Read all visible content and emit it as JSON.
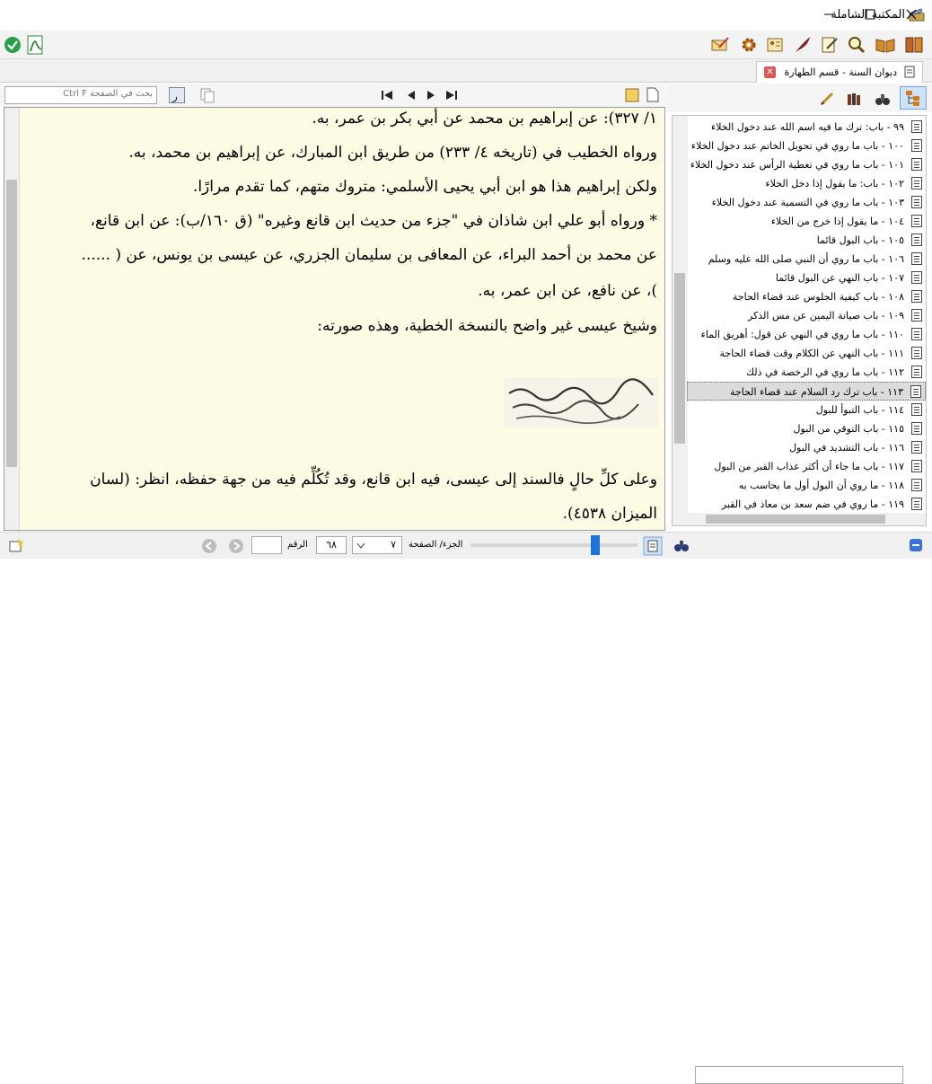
{
  "window": {
    "title": "المكتبة الشاملة"
  },
  "tab": {
    "label": "ديوان السنة - قسم الطهارة"
  },
  "reader": {
    "search_placeholder": "بحث في الصفحة  Ctrl  F",
    "lines": [
      "١/ ٣٢٧): عن إبراهيم بن محمد عن أبي بكر بن عمر، به.",
      "ورواه الخطيب في (تاريخه ٤/ ٢٣٣) من طريق ابن المبارك، عن إبراهيم بن محمد، به.",
      "ولكن إبراهيم هذا هو ابن أبي يحيى الأسلمي: متروك متهم، كما تقدم مرارًا.",
      "* ورواه أبو علي ابن شاذان في \"جزء من حديث ابن قانع وغيره\" (ق ١٦٠/ب): عن ابن قانع،",
      "عن محمد بن أحمد البراء، عن المعافى بن سليمان الجزري، عن عيسى بن يونس، عن ( ......",
      ")، عن نافع، عن ابن عمر، به.",
      "وشيخ عيسى غير واضح بالنسخة الخطية، وهذه صورته:",
      "وعلى كلِّ حالٍ فالسند إلى عيسى، فيه ابن قانع، وقد تُكُلِّم فيه من جهة حفظه، انظر: (لسان",
      "الميزان ٤٥٣٨)."
    ]
  },
  "statusbar": {
    "part_label": "الجزء/ الصفحة",
    "part_value": "٧",
    "page_value": "٦٨",
    "number_label": "الرقم",
    "number_value": ""
  },
  "tree": {
    "items": [
      {
        "label": "٩٩ - باب: ترك ما فيه اسم الله عند دخول الخلاء"
      },
      {
        "label": "١٠٠ - باب ما روي في تحويل الخاتم عند دخول الخلاء"
      },
      {
        "label": "١٠١ - باب ما روي في تغطية الرأس عند دخول الخلاء"
      },
      {
        "label": "١٠٢ - باب: ما يقول إذا دخل الخلاء"
      },
      {
        "label": "١٠٣ - باب ما روي في التسمية عند دخول الخلاء"
      },
      {
        "label": "١٠٤ - ما يقول إذا خرج من الخلاء"
      },
      {
        "label": "١٠٥ - باب البول قائما"
      },
      {
        "label": "١٠٦ - باب ما روي أن النبي صلى الله عليه وسلم"
      },
      {
        "label": "١٠٧ - باب النهي عن البول قائما"
      },
      {
        "label": "١٠٨ - باب كيفية الجلوس عند قضاء الحاجة"
      },
      {
        "label": "١٠٩ - باب صيانة اليمين عن مس الذكر"
      },
      {
        "label": "١١٠ - باب ما روي في النهي عن قول: أهريق الماء"
      },
      {
        "label": "١١١ - باب النهي عن الكلام وقت قضاء الحاجة"
      },
      {
        "label": "١١٢ - باب ما روي في الرخصة في ذلك"
      },
      {
        "label": "١١٣ - باب ترك رد السلام عند قضاء الحاجة"
      },
      {
        "label": "١١٤ - باب التبوأ للبول"
      },
      {
        "label": "١١٥ - باب التوقي من البول"
      },
      {
        "label": "١١٦ - باب التشديد في البول"
      },
      {
        "label": "١١٧ - باب ما جاء أن أكثر عذاب القبر من البول"
      },
      {
        "label": "١١٨ - ما روي أن البول أول ما يحاسب به"
      },
      {
        "label": "١١٩ - ما روي في ضم سعد بن معاذ في القبر"
      }
    ],
    "selected_index": 14
  },
  "colors": {
    "reader_bg": "#fdfbe3",
    "selection": "#dcdcdc",
    "close": "#e05555"
  }
}
